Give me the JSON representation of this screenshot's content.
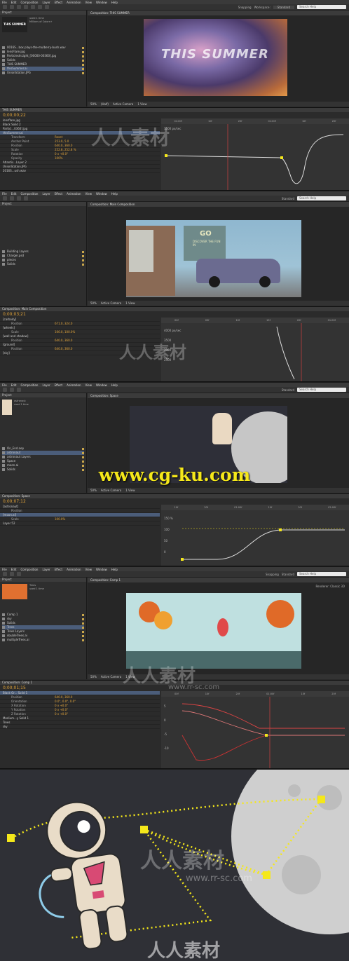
{
  "colors": {
    "accent": "#e3a53a",
    "selection": "#4b5d7a",
    "handles": "#f5e81a"
  },
  "menus": [
    "File",
    "Edit",
    "Composition",
    "Layer",
    "Effect",
    "Animation",
    "View",
    "Window",
    "Help"
  ],
  "toolbar": {
    "snapping": "Snapping",
    "workspace_label": "Workspace:",
    "workspace_value": "Standard",
    "search_placeholder": "Search Help"
  },
  "shot1": {
    "project_tab": "Project",
    "thumb_info": "used 1 time",
    "thumb_info2": "Millions of Colors+",
    "comp_tab": "Composition: THIS SUMMER",
    "comp_title": "THIS SUMMER",
    "zoom": "50%",
    "view": "(Half)",
    "camera": "Active Camera",
    "views": "1 View",
    "timeline_tab": "THIS SUMMER",
    "timecode": "0;00;00;22",
    "files": [
      "0016S...box plays-the-mulberry-bush.wav",
      "lensFlare.jpg",
      "ParticlesInLight_[00000-00360].jpg",
      "Solids",
      "THIS SUMMER",
      "thisSummer.ai",
      "UnionStation.JPG"
    ],
    "layers": [
      "lensflare.jpg",
      "Black Solid 2",
      "Particl...0360].jpg",
      "thisSummer.ai",
      "Transform",
      "Anchor Point",
      "Position",
      "Scale",
      "Rotation",
      "Opacity",
      "Atlantis...Layer 2",
      "UnionStation.JPG",
      "2016S...ush.wav"
    ],
    "values": [
      "",
      "",
      "",
      "",
      "Reset",
      "253.0, 5.0",
      "640.0, 360.0",
      "252.8, 252.8 %",
      "0 x +0.0°",
      "100%",
      "",
      "",
      ""
    ],
    "graph_label": "1500 px/sec"
  },
  "shot2": {
    "comp_tab": "Composition: Main Composition",
    "files": [
      "Building Layers",
      "Charger.psd",
      "pieces",
      "Solids"
    ],
    "timecode": "0;00;03;21",
    "layers": [
      "[carbody]",
      "Position",
      "[wheels]",
      "Scale",
      "[wall and shadow]",
      "Position",
      "[ground]",
      "Position",
      "[sky]"
    ],
    "values": [
      "",
      "671.0, 324.0",
      "",
      "100.0, 100.0%",
      "",
      "640.0, 360.0",
      "",
      "640.0, 360.0",
      ""
    ],
    "graph_labels": [
      "4000 px/sec",
      "3500",
      "3000",
      "2500"
    ],
    "billboard_text": "GO",
    "billboard_sub": "DISCOVER THE FUN IN"
  },
  "shot3": {
    "comp_tab": "Composition: Space",
    "item_name": "astronaut",
    "item_info": "used 1 time",
    "files": [
      "On_End.aep",
      "astronaut",
      "astronaut Layers",
      "Space",
      "moon.ai",
      "Solids"
    ],
    "timecode": "0;00;07;12",
    "layers": [
      "[astronaut]",
      "Position",
      "[moon.ai]",
      "Scale",
      "Layer 52"
    ],
    "values": [
      "",
      "",
      "",
      "100.0%",
      ""
    ],
    "graph_labels": [
      "150 %",
      "100",
      "50",
      "0"
    ]
  },
  "watermark_url": "www.cg-ku.com",
  "shot4": {
    "comp_tab": "Composition: Comp 1",
    "item_name": "Trees",
    "item_info": "used 1 time",
    "files": [
      "Comp 1",
      "sky",
      "Solids",
      "Trees",
      "Trees Layers",
      "doubleTrees.ai",
      "multipleTrees.ai"
    ],
    "timecode": "0;00;01;15",
    "layers": [
      "Black Or... Solid 1",
      "Position",
      "Orientation",
      "X Rotation",
      "Y Rotation",
      "Z Rotation",
      "Medium...y Solid 1",
      "Trees",
      "sky"
    ],
    "values": [
      "",
      "640.0, 360.0",
      "0.0°, 0.0°, 0.0°",
      "0 x +0.0°",
      "0 x +0.0°",
      "0 x +0.0°",
      "",
      "",
      ""
    ],
    "graph_labels": [
      "5",
      "0",
      "-5",
      "-10"
    ],
    "renderer": "Renderer: Classic 3D"
  },
  "watermarks": [
    "人人素材",
    "www.rr-sc.com"
  ]
}
